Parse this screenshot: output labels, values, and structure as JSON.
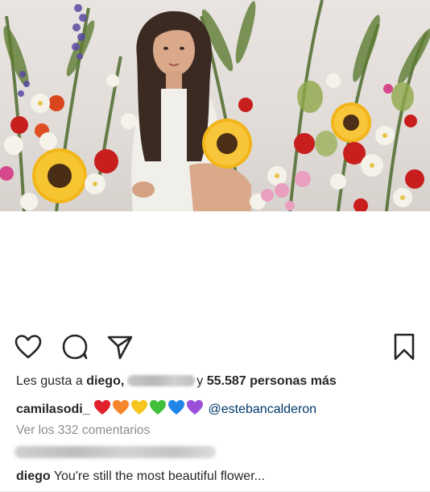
{
  "actions": {
    "like_icon": "heart-icon",
    "comment_icon": "comment-icon",
    "share_icon": "send-icon",
    "save_icon": "bookmark-icon"
  },
  "likes": {
    "prefix": "Les gusta a",
    "first_user": "diego,",
    "suffix_joiner": "y",
    "others": "55.587 personas más"
  },
  "caption": {
    "username": "camilasodi_",
    "hearts": [
      "#e0202a",
      "#f5862b",
      "#f7c51e",
      "#3fbf3a",
      "#1f86e8",
      "#9b4fd8"
    ],
    "mention": "@estebancalderon"
  },
  "view_comments": "Ver los 332 comentarios",
  "comment": {
    "username": "diego",
    "text": "You're still the most beautiful flower..."
  },
  "colors": {
    "text": "#262626",
    "muted": "#8e8e8e",
    "link": "#00376b"
  }
}
